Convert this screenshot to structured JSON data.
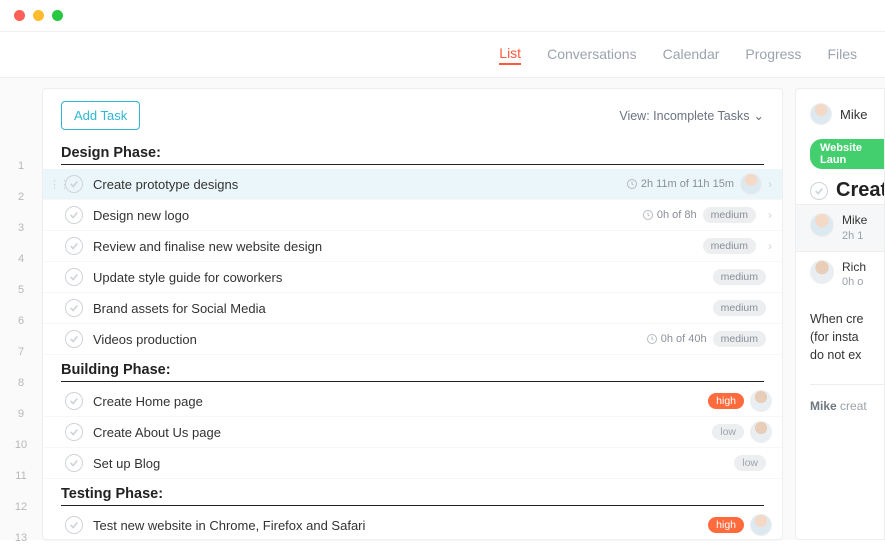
{
  "tabs": [
    "List",
    "Conversations",
    "Calendar",
    "Progress",
    "Files"
  ],
  "active_tab": "List",
  "add_button": "Add Task",
  "view_label": "View: Incomplete Tasks",
  "rows": [
    {
      "n": 1,
      "type": "section",
      "title": "Design Phase:"
    },
    {
      "n": 2,
      "type": "task",
      "title": "Create prototype designs",
      "time": "2h 11m of 11h 15m",
      "avatar": "a1",
      "selected": true,
      "chev": true
    },
    {
      "n": 3,
      "type": "task",
      "title": "Design new logo",
      "time": "0h of 8h",
      "priority": "medium",
      "chev": true
    },
    {
      "n": 4,
      "type": "task",
      "title": "Review and finalise new website design",
      "priority": "medium",
      "chev": true
    },
    {
      "n": 5,
      "type": "task",
      "title": "Update style guide for coworkers",
      "priority": "medium"
    },
    {
      "n": 6,
      "type": "task",
      "title": "Brand assets for Social Media",
      "priority": "medium"
    },
    {
      "n": 7,
      "type": "task",
      "title": "Videos production",
      "time": "0h of 40h",
      "priority": "medium"
    },
    {
      "n": 8,
      "type": "section",
      "title": "Building Phase:"
    },
    {
      "n": 9,
      "type": "task",
      "title": "Create Home page",
      "priority": "high",
      "avatar": "a2"
    },
    {
      "n": 10,
      "type": "task",
      "title": "Create About Us page",
      "priority": "low",
      "avatar": "a2"
    },
    {
      "n": 11,
      "type": "task",
      "title": "Set up Blog",
      "priority": "low"
    },
    {
      "n": 12,
      "type": "section",
      "title": "Testing Phase:"
    },
    {
      "n": 13,
      "type": "task",
      "title": "Test new website in Chrome, Firefox and Safari",
      "priority": "high",
      "avatar": "a1"
    }
  ],
  "side": {
    "user": "Mike",
    "badge": "Website Laun",
    "title": "Creat",
    "assignees": [
      {
        "name": "Mike",
        "sub": "2h 1",
        "cls": "a1"
      },
      {
        "name": "Rich",
        "sub": "0h o",
        "cls": "a2"
      }
    ],
    "desc_lines": [
      "When cre",
      "(for insta",
      "do not ex"
    ],
    "meta_bold": "Mike",
    "meta_rest": " creat"
  }
}
